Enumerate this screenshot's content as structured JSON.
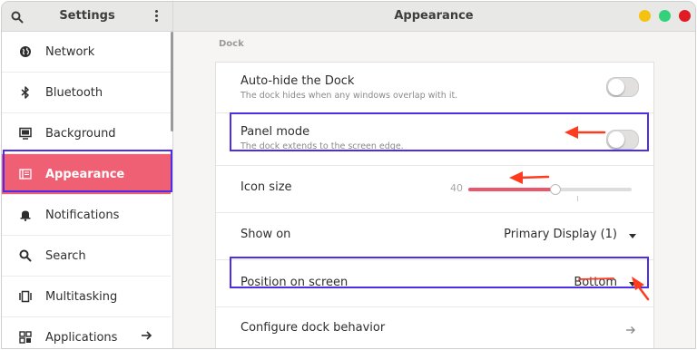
{
  "sidebar_header": {
    "title": "Settings"
  },
  "main_header": {
    "title": "Appearance"
  },
  "sidebar": {
    "items": [
      {
        "label": "Network",
        "icon": "globe-icon"
      },
      {
        "label": "Bluetooth",
        "icon": "bluetooth-icon"
      },
      {
        "label": "Background",
        "icon": "monitor-icon"
      },
      {
        "label": "Appearance",
        "icon": "appearance-icon",
        "active": true
      },
      {
        "label": "Notifications",
        "icon": "notifications-icon"
      },
      {
        "label": "Search",
        "icon": "search-icon"
      },
      {
        "label": "Multitasking",
        "icon": "multitasking-icon"
      },
      {
        "label": "Applications",
        "icon": "applications-icon"
      }
    ]
  },
  "dock": {
    "section_label": "Dock",
    "autohide": {
      "title": "Auto-hide the Dock",
      "subtitle": "The dock hides when any windows overlap with it.",
      "enabled": false
    },
    "panel_mode": {
      "title": "Panel mode",
      "subtitle": "The dock extends to the screen edge.",
      "enabled": false
    },
    "icon_size": {
      "title": "Icon size",
      "value": "40",
      "fraction": 0.53
    },
    "show_on": {
      "title": "Show on",
      "value": "Primary Display (1)"
    },
    "position": {
      "title": "Position on screen",
      "value": "Bottom"
    },
    "configure": {
      "title": "Configure dock behavior"
    }
  },
  "colors": {
    "accent": "#f06075",
    "highlight_box": "#4b2ee6",
    "annotation": "#ff3b1f"
  }
}
